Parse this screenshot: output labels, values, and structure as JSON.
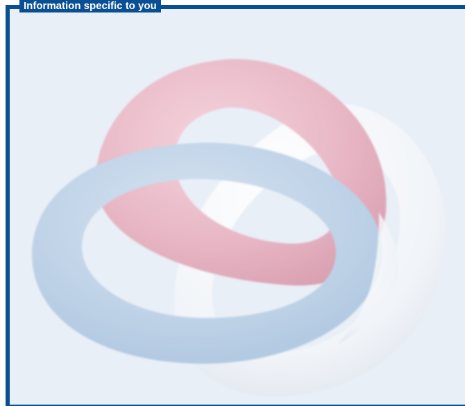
{
  "panel": {
    "title": "Information specific to you"
  },
  "graphic": {
    "icon": "interlocking-rings-icon",
    "colors": {
      "border": "#0a4f93",
      "background": "#e9eff7",
      "ring_red": "#e8b9c6",
      "ring_blue": "#bdd2e6",
      "ring_white": "#f2f5f9"
    }
  }
}
